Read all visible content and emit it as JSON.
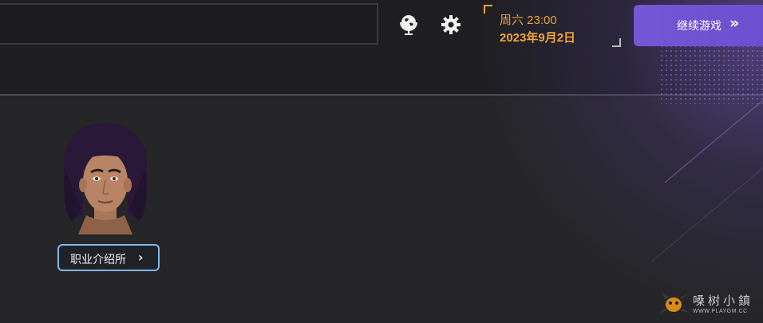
{
  "header": {
    "search_value": "",
    "date": {
      "day_time": "周六 23:00",
      "date": "2023年9月2日"
    },
    "continue_button": {
      "label": "继续游戏",
      "arrows": "»"
    },
    "icons": {
      "globe": "globe-icon",
      "settings": "gear-icon"
    }
  },
  "main": {
    "job_center_button": {
      "label": "职业介绍所",
      "chevron": "›"
    }
  },
  "watermark": {
    "text": "嗓树小鎮",
    "sub": "WWW.PLAYGM.CC"
  },
  "colors": {
    "accent_orange": "#e6a23c",
    "button_purple": "#7457d6",
    "button_border_blue": "#7fb6ea",
    "background": "#262628",
    "topbar": "#1f1f21"
  }
}
